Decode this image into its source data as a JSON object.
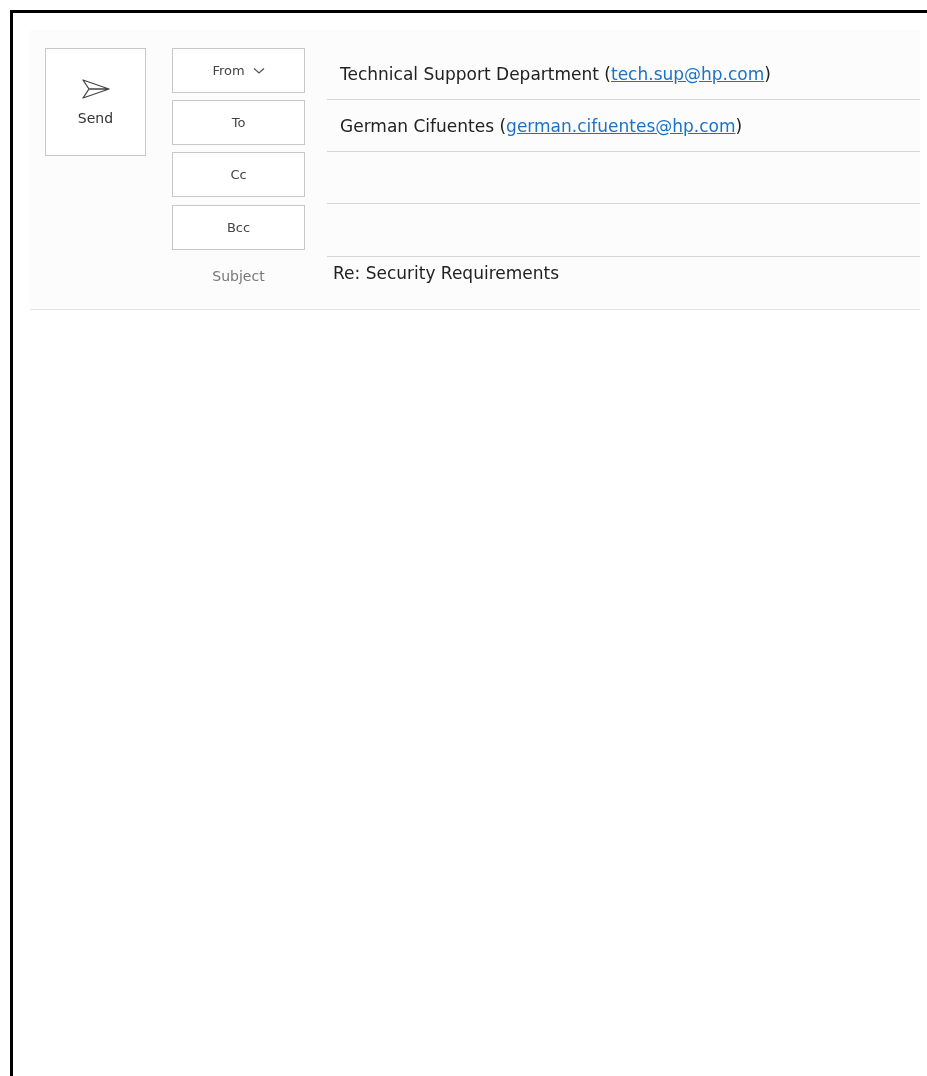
{
  "send_button": {
    "label": "Send"
  },
  "fields": [
    {
      "kind": "button",
      "label": "From",
      "dropdown": true,
      "text": "Technical Support Department (",
      "link": "tech.sup@hp.com",
      "after": ")"
    },
    {
      "kind": "button",
      "label": "To",
      "dropdown": false,
      "text": "German Cifuentes (",
      "link": "german.cifuentes@hp.com",
      "after": ")"
    },
    {
      "kind": "button",
      "label": "Cc",
      "dropdown": false
    },
    {
      "kind": "button",
      "label": "Bcc",
      "dropdown": false
    },
    {
      "kind": "label",
      "label": "Subject",
      "value": "Re: Security Requirements"
    }
  ]
}
